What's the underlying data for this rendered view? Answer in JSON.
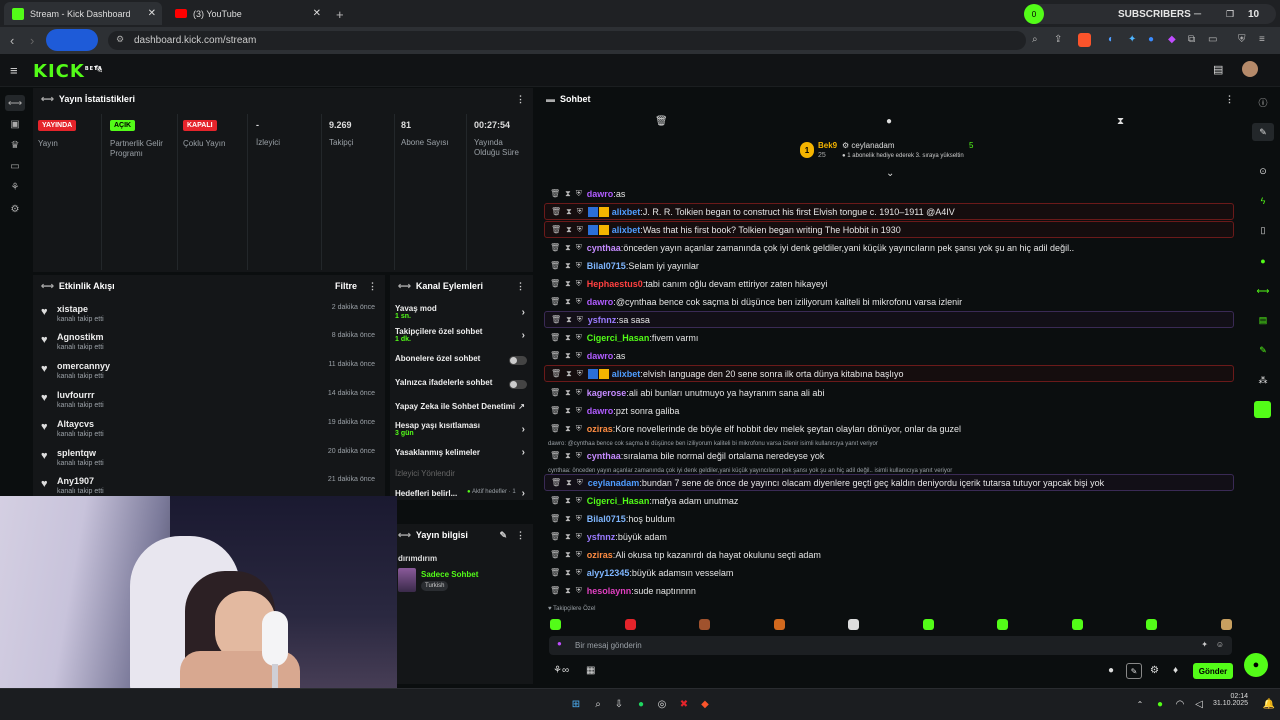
{
  "browser": {
    "tabs": [
      {
        "label": "Stream - Kick Dashboard",
        "active": true
      },
      {
        "label": "(3) YouTube",
        "active": false
      }
    ],
    "url": "dashboard.kick.com/stream",
    "subs_widget": {
      "label": "SUBSCRIBERS",
      "count": "10",
      "badge": "0"
    }
  },
  "app": {
    "logo": "KICK",
    "logo_sup": "BETA"
  },
  "stats": {
    "title": "Yayın İstatistikleri",
    "items": [
      {
        "pill": "YAYINDA",
        "pill_color": "#e5242b",
        "label": "Yayın"
      },
      {
        "pill": "AÇIK",
        "pill_color": "#53fc18",
        "label": "Partnerlik Gelir Programı"
      },
      {
        "pill": "KAPALI",
        "pill_color": "#e5242b",
        "label": "Çoklu Yayın"
      },
      {
        "value": "-",
        "label": "İzleyici"
      },
      {
        "value": "9.269",
        "label": "Takipçi"
      },
      {
        "value": "81",
        "label": "Abone Sayısı"
      },
      {
        "value": "00:27:54",
        "label": "Yayında Olduğu Süre"
      }
    ]
  },
  "activity": {
    "title": "Etkinlik Akışı",
    "filter": "Filtre",
    "items": [
      {
        "name": "xistape",
        "sub": "kanalı takip etti",
        "time": "2 dakika önce"
      },
      {
        "name": "Agnostikm",
        "sub": "kanalı takip etti",
        "time": "8 dakika önce"
      },
      {
        "name": "omercannyy",
        "sub": "kanalı takip etti",
        "time": "11 dakika önce"
      },
      {
        "name": "luvfourrr",
        "sub": "kanalı takip etti",
        "time": "14 dakika önce"
      },
      {
        "name": "Altaycvs",
        "sub": "kanalı takip etti",
        "time": "19 dakika önce"
      },
      {
        "name": "splentqw",
        "sub": "kanalı takip etti",
        "time": "20 dakika önce"
      },
      {
        "name": "Any1907",
        "sub": "kanalı takip etti",
        "time": "21 dakika önce"
      }
    ]
  },
  "channel_actions": {
    "title": "Kanal Eylemleri",
    "items": [
      {
        "label": "Yavaş mod",
        "sub": "1 sn.",
        "control": "chevron"
      },
      {
        "label": "Takipçilere özel sohbet",
        "sub": "1 dk.",
        "control": "chevron"
      },
      {
        "label": "Abonelere özel sohbet",
        "sub": "",
        "control": "toggle"
      },
      {
        "label": "Yalnızca ifadelerle sohbet",
        "sub": "",
        "control": "toggle"
      },
      {
        "label": "Yapay Zeka ile Sohbet Denetimi",
        "sub": "",
        "control": "external"
      },
      {
        "label": "Hesap yaşı kısıtlaması",
        "sub": "3 gün",
        "control": "chevron"
      },
      {
        "label": "Yasaklanmış kelimeler",
        "sub": "",
        "control": "chevron"
      },
      {
        "label": "İzleyici Yönlendir",
        "sub": "",
        "control": "none"
      }
    ],
    "goals_label": "Hedefleri belirl...",
    "goals_status": "Aktif hedefler · 1"
  },
  "stream_info": {
    "title": "Yayın bilgisi",
    "stream_title": "dırımdırım",
    "category": "Sadece Sohbet",
    "tag": "Turkish"
  },
  "chat": {
    "title": "Sohbet",
    "pinned": {
      "rank": "1",
      "top_user": "Bek9",
      "top_user_count": "25",
      "gifter": "ceylanadam",
      "gift_count": "5",
      "gift_text": "1 abonelik hediye ederek 3. sıraya yükseltin"
    },
    "messages": [
      {
        "user": "dawro",
        "color": "#b05cff",
        "text": "as",
        "highlight": ""
      },
      {
        "user": "alixbet",
        "color": "#4f9dff",
        "text": "J. R. R. Tolkien began to construct his first Elvish tongue c. 1910–1911 @A4IV",
        "highlight": "red",
        "badges": true
      },
      {
        "user": "alixbet",
        "color": "#4f9dff",
        "text": "Was that his first book? Tolkien began writing The Hobbit in 1930",
        "highlight": "red",
        "badges": true
      },
      {
        "user": "cynthaa",
        "color": "#c58bff",
        "text": "önceden yayın açanlar zamanında çok iyi denk geldiler,yani küçük yayıncıların pek şansı yok şu an hiç adil değil..",
        "highlight": ""
      },
      {
        "user": "Bilal0715",
        "color": "#7fb6ff",
        "text": "Selam iyi yayınlar",
        "highlight": ""
      },
      {
        "user": "Hephaestus0",
        "color": "#ff4040",
        "text": "tabi canım oğlu devam ettiriyor zaten hikayeyi",
        "highlight": ""
      },
      {
        "user": "dawro",
        "color": "#b05cff",
        "text": "@cynthaa bence cok saçma bi düşünce ben iziliyorum kaliteli bi mikrofonu varsa izlenir",
        "highlight": ""
      },
      {
        "user": "ysfnnz",
        "color": "#9a7bff",
        "text": "sa sasa",
        "highlight": "purple"
      },
      {
        "user": "Cigerci_Hasan",
        "color": "#53fc18",
        "text": "fivem varmı",
        "highlight": ""
      },
      {
        "user": "dawro",
        "color": "#b05cff",
        "text": "as",
        "highlight": ""
      },
      {
        "user": "alixbet",
        "color": "#4f9dff",
        "text": "elvish language den 20 sene sonra ilk orta dünya kitabına başlıyo",
        "highlight": "red",
        "badges": true
      },
      {
        "user": "kagerose",
        "color": "#c58bff",
        "text": "ali abi bunları unutmuyo ya hayranım sana ali abi",
        "highlight": ""
      },
      {
        "user": "dawro",
        "color": "#b05cff",
        "text": "pzt sonra galiba",
        "highlight": ""
      },
      {
        "user": "oziras",
        "color": "#ff8c42",
        "text": "Kore novellerinde de böyle elf hobbit dev melek şeytan olayları dönüyor, onlar da guzel",
        "highlight": ""
      },
      {
        "user": "cynthaa",
        "color": "#c58bff",
        "text": "sıralama bile normal değil ortalama neredeyse yok",
        "highlight": "",
        "reply": "dawro: @cynthaa bence cok saçma bi düşünce ben iziliyorum kaliteli bi mikrofonu varsa izlenir isimli kullanıcıya yanıt veriyor"
      },
      {
        "user": "ceylanadam",
        "color": "#4f9dff",
        "text": "bundan 7 sene de önce de yayıncı olacam diyenlere geçti geç kaldın deniyordu içerik tutarsa tutuyor yapcak bişi yok",
        "highlight": "purple",
        "reply": "cynthaa: önceden yayın açanlar zamanında çok iyi denk geldiler,yani küçük yayıncıların pek şansı yok şu an hiç adil değil.. isimli kullanıcıya yanıt veriyor"
      },
      {
        "user": "Cigerci_Hasan",
        "color": "#53fc18",
        "text": "mafya adam unutmaz",
        "highlight": ""
      },
      {
        "user": "Bilal0715",
        "color": "#7fb6ff",
        "text": "hoş buldum",
        "highlight": ""
      },
      {
        "user": "ysfnnz",
        "color": "#9a7bff",
        "text": "büyük adam",
        "highlight": ""
      },
      {
        "user": "oziras",
        "color": "#ff8c42",
        "text": "Ali okusa tıp kazanırdı da hayat okulunu seçti adam",
        "highlight": ""
      },
      {
        "user": "alyy12345",
        "color": "#7fb6ff",
        "text": "büyük adamsın vesselam",
        "highlight": ""
      },
      {
        "user": "hesolaynn",
        "color": "#e040c0",
        "text": "sude naptınnnn",
        "highlight": ""
      }
    ],
    "followers_only": "Takipçilere Özel",
    "input_placeholder": "Bir mesaj gönderin",
    "send": "Gönder"
  },
  "taskbar": {
    "time": "02:14",
    "date": "31.10.2025"
  }
}
